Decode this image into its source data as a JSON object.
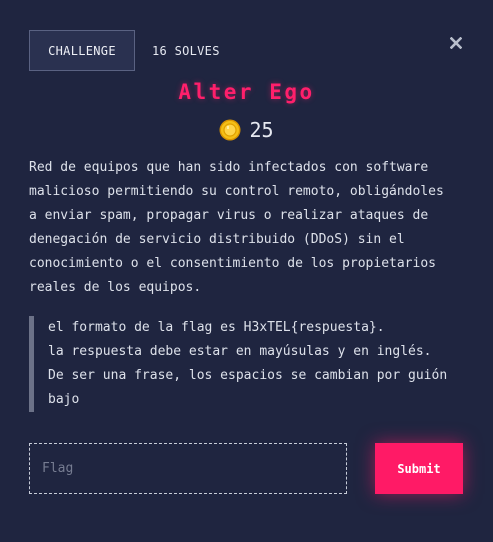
{
  "tabs": {
    "challenge_label": "CHALLENGE",
    "solves_label": "16 SOLVES"
  },
  "close_icon": "close-icon",
  "challenge": {
    "title": "Alter Ego",
    "points": "25",
    "points_icon": "coin-icon",
    "description": "Red de equipos que han sido infectados con software\nmalicioso permitiendo su control remoto, obligándoles\na enviar spam, propagar virus o realizar ataques de\ndenegación de servicio distribuido (DDoS) sin el\nconocimiento o el consentimiento de los propietarios\nreales de los equipos.",
    "hint_lines": [
      "el formato de la flag es H3xTEL{respuesta}.",
      "la respuesta debe estar en mayúsulas y en inglés.",
      "De ser una frase, los espacios se cambian por guión",
      "bajo"
    ]
  },
  "form": {
    "flag_value": "",
    "flag_placeholder": "Flag",
    "submit_label": "Submit"
  },
  "colors": {
    "background": "#1f2540",
    "accent": "#ff1a66",
    "coin": "#f2b705"
  }
}
